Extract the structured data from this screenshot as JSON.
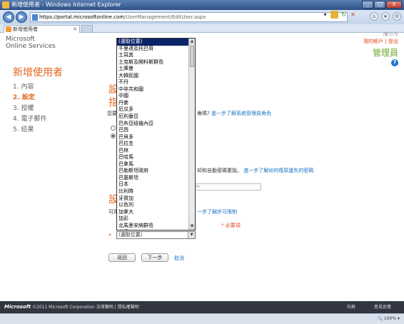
{
  "window": {
    "title": "新增使用者 - Windows Internet Explorer",
    "buttons": [
      "_",
      "□",
      "X"
    ]
  },
  "address": {
    "domain": "https://portal.microsoftonline.com",
    "path": "/UserManagement/EditUser.aspx"
  },
  "tab": {
    "label": "新增使用者"
  },
  "logo": {
    "line1": "Microsoft",
    "line2": "Online Services"
  },
  "user": {
    "name": "陳小冷",
    "links": "我的帳戶 | 登出",
    "role": "管理員"
  },
  "page": {
    "title": "新增使用者",
    "steps": [
      "1. 內容",
      "2. 設定",
      "3. 授權",
      "4. 電子郵件",
      "5. 結果"
    ],
    "section1": "設",
    "section2": "指",
    "q_text": "您要",
    "q_text_suffix": "角嗎?",
    "q_link": "進一步了解系統管理員角色",
    "pwd_text": "却和自動密碼重設。",
    "pwd_link": "進一步了解如何復原遺失的密碼",
    "field_hint": "m",
    "section3": "設",
    "loc_text": "可用",
    "loc_link": "一步了解許可限制",
    "required": "* 必要項",
    "asterisk": "*",
    "back": "返回",
    "next": "下一步",
    "cancel": "取消"
  },
  "dropdown": {
    "items": [
      "(選取位置)",
      "千里達及托巴哥",
      "土耳其",
      "土克斯及開科斯群島",
      "土庫曼",
      "大韓民國",
      "不丹",
      "中非共和國",
      "中國",
      "丹麥",
      "厄瓜多",
      "厄利垂亞",
      "巴布亞紐幾內亞",
      "巴西",
      "巴貝多",
      "巴拉圭",
      "巴林",
      "巴哈馬",
      "巴拿馬",
      "巴勒斯坦政府",
      "巴基斯坦",
      "日本",
      "比利時",
      "牙買加",
      "以色列",
      "加拿大",
      "加彭",
      "北馬里安納群島",
      "卡達",
      "可可斯群島"
    ],
    "selected_value": "(選取位置)"
  },
  "footer": {
    "logo": "Microsoft",
    "copyright": "©2011 Microsoft Corporation  法律聲明  |  隱私權聲明",
    "right1": "社群",
    "right2": "意見反應"
  },
  "statusbar": {
    "zoom": "100%"
  }
}
